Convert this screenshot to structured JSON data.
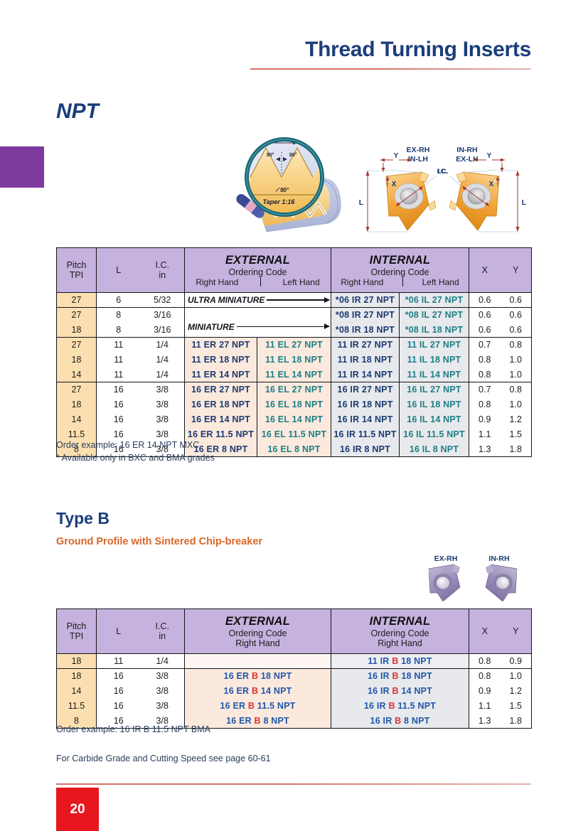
{
  "header": {
    "title": "Thread Turning Inserts"
  },
  "section1": {
    "title": "NPT",
    "magnifier": {
      "pitch_label": "P",
      "angle_left": "30°",
      "angle_right": "30°",
      "angle_center": "90°",
      "taper": "Taper 1:16"
    },
    "insert_diagram": {
      "left_label_line1": "EX-RH",
      "left_label_line2": "IN-LH",
      "right_label_line1": "IN-RH",
      "right_label_line2": "EX-LH",
      "dim_x": "X",
      "dim_y": "Y",
      "dim_l": "L",
      "dim_ic": "I.C."
    },
    "table": {
      "headers": {
        "pitch": "Pitch",
        "pitch_unit": "TPI",
        "l": "L",
        "ic": "I.C.",
        "ic_unit": "in",
        "external": "EXTERNAL",
        "internal": "INTERNAL",
        "ordering_code": "Ordering Code",
        "right_hand": "Right Hand",
        "left_hand": "Left Hand",
        "x": "X",
        "y": "Y"
      },
      "group_labels": {
        "ultra_miniature": "ULTRA MINIATURE",
        "miniature": "MINIATURE"
      },
      "rows": [
        {
          "pitch": "27",
          "l": "6",
          "ic": "5/32",
          "ext_rh": "",
          "ext_lh": "",
          "int_rh": "*06 IR 27   NPT",
          "int_lh": "*06 IL 27   NPT",
          "x": "0.6",
          "y": "0.6",
          "group": 1
        },
        {
          "pitch": "27",
          "l": "8",
          "ic": "3/16",
          "ext_rh": "",
          "ext_lh": "",
          "int_rh": "*08 IR 27   NPT",
          "int_lh": "*08 IL 27   NPT",
          "x": "0.6",
          "y": "0.6",
          "group": 2
        },
        {
          "pitch": "18",
          "l": "8",
          "ic": "3/16",
          "ext_rh": "",
          "ext_lh": "",
          "int_rh": "*08 IR 18   NPT",
          "int_lh": "*08 IL 18   NPT",
          "x": "0.6",
          "y": "0.6",
          "group": 2
        },
        {
          "pitch": "27",
          "l": "11",
          "ic": "1/4",
          "ext_rh": "11 ER 27   NPT",
          "ext_lh": "11 EL 27   NPT",
          "int_rh": "11 IR 27   NPT",
          "int_lh": "11 IL 27   NPT",
          "x": "0.7",
          "y": "0.8",
          "group": 3
        },
        {
          "pitch": "18",
          "l": "11",
          "ic": "1/4",
          "ext_rh": "11 ER 18   NPT",
          "ext_lh": "11 EL 18   NPT",
          "int_rh": "11 IR 18   NPT",
          "int_lh": "11 IL 18   NPT",
          "x": "0.8",
          "y": "1.0",
          "group": 3
        },
        {
          "pitch": "14",
          "l": "11",
          "ic": "1/4",
          "ext_rh": "11 ER 14   NPT",
          "ext_lh": "11 EL 14   NPT",
          "int_rh": "11 IR 14   NPT",
          "int_lh": "11 IL 14   NPT",
          "x": "0.8",
          "y": "1.0",
          "group": 3
        },
        {
          "pitch": "27",
          "l": "16",
          "ic": "3/8",
          "ext_rh": "16 ER 27   NPT",
          "ext_lh": "16 EL 27   NPT",
          "int_rh": "16 IR 27   NPT",
          "int_lh": "16 IL 27   NPT",
          "x": "0.7",
          "y": "0.8",
          "group": 4
        },
        {
          "pitch": "18",
          "l": "16",
          "ic": "3/8",
          "ext_rh": "16 ER 18   NPT",
          "ext_lh": "16 EL 18   NPT",
          "int_rh": "16 IR 18   NPT",
          "int_lh": "16 IL 18   NPT",
          "x": "0.8",
          "y": "1.0",
          "group": 4
        },
        {
          "pitch": "14",
          "l": "16",
          "ic": "3/8",
          "ext_rh": "16 ER 14   NPT",
          "ext_lh": "16 EL 14   NPT",
          "int_rh": "16 IR 14   NPT",
          "int_lh": "16 IL 14   NPT",
          "x": "0.9",
          "y": "1.2",
          "group": 4
        },
        {
          "pitch": "11.5",
          "l": "16",
          "ic": "3/8",
          "ext_rh": "16 ER 11.5 NPT",
          "ext_lh": "16 EL 11.5 NPT",
          "int_rh": "16 IR 11.5 NPT",
          "int_lh": "16 IL 11.5 NPT",
          "x": "1.1",
          "y": "1.5",
          "group": 4
        },
        {
          "pitch": "8",
          "l": "16",
          "ic": "3/8",
          "ext_rh": "16 ER  8   NPT",
          "ext_lh": "16 EL  8   NPT",
          "int_rh": "16 IR  8   NPT",
          "int_lh": "16 IL  8   NPT",
          "x": "1.3",
          "y": "1.8",
          "group": 4
        }
      ],
      "notes": [
        "Order example: 16 ER 14 NPT MXC",
        "* Available only in BXC and BMA grades"
      ]
    }
  },
  "section2": {
    "title": "Type B",
    "subtitle": "Ground Profile with Sintered Chip-breaker",
    "insert_diagram": {
      "left_label": "EX-RH",
      "right_label": "IN-RH"
    },
    "table": {
      "headers": {
        "pitch": "Pitch",
        "pitch_unit": "TPI",
        "l": "L",
        "ic": "I.C.",
        "ic_unit": "in",
        "external": "EXTERNAL",
        "internal": "INTERNAL",
        "ordering_code": "Ordering Code",
        "right_hand": "Right Hand",
        "x": "X",
        "y": "Y"
      },
      "rows": [
        {
          "pitch": "18",
          "l": "11",
          "ic": "1/4",
          "ext_pre": "",
          "ext_b": "",
          "ext_post": "",
          "int_pre": "11 IR ",
          "int_b": "B",
          "int_post": " 18   NPT",
          "x": "0.8",
          "y": "0.9",
          "group": 1
        },
        {
          "pitch": "18",
          "l": "16",
          "ic": "3/8",
          "ext_pre": "16 ER ",
          "ext_b": "B",
          "ext_post": " 18   NPT",
          "int_pre": "16 IR ",
          "int_b": "B",
          "int_post": " 18   NPT",
          "x": "0.8",
          "y": "1.0",
          "group": 2
        },
        {
          "pitch": "14",
          "l": "16",
          "ic": "3/8",
          "ext_pre": "16 ER ",
          "ext_b": "B",
          "ext_post": " 14   NPT",
          "int_pre": "16 IR ",
          "int_b": "B",
          "int_post": " 14   NPT",
          "x": "0.9",
          "y": "1.2",
          "group": 2
        },
        {
          "pitch": "11.5",
          "l": "16",
          "ic": "3/8",
          "ext_pre": "16 ER ",
          "ext_b": "B",
          "ext_post": " 11.5 NPT",
          "int_pre": "16 IR ",
          "int_b": "B",
          "int_post": " 11.5 NPT",
          "x": "1.1",
          "y": "1.5",
          "group": 2
        },
        {
          "pitch": "8",
          "l": "16",
          "ic": "3/8",
          "ext_pre": "16 ER ",
          "ext_b": "B",
          "ext_post": "  8   NPT",
          "int_pre": "16 IR ",
          "int_b": "B",
          "int_post": "  8   NPT",
          "x": "1.3",
          "y": "1.8",
          "group": 2
        }
      ],
      "notes": [
        "Order example: 16 IR B 11.5 NPT BMA",
        "For Carbide Grade and Cutting Speed see page 60-61"
      ]
    }
  },
  "footer": {
    "page_number": "20"
  },
  "colors": {
    "brand_blue": "#1b3e7a",
    "accent_orange": "#d8662a",
    "accent_red": "#e8171f",
    "header_purple": "#c5b2de",
    "tab_purple": "#7d3a9e",
    "pitch_tan": "#fbdfb0",
    "code_rh": "#1b3a72",
    "code_lh": "#1d7f86",
    "code_b_red": "#e03131"
  }
}
